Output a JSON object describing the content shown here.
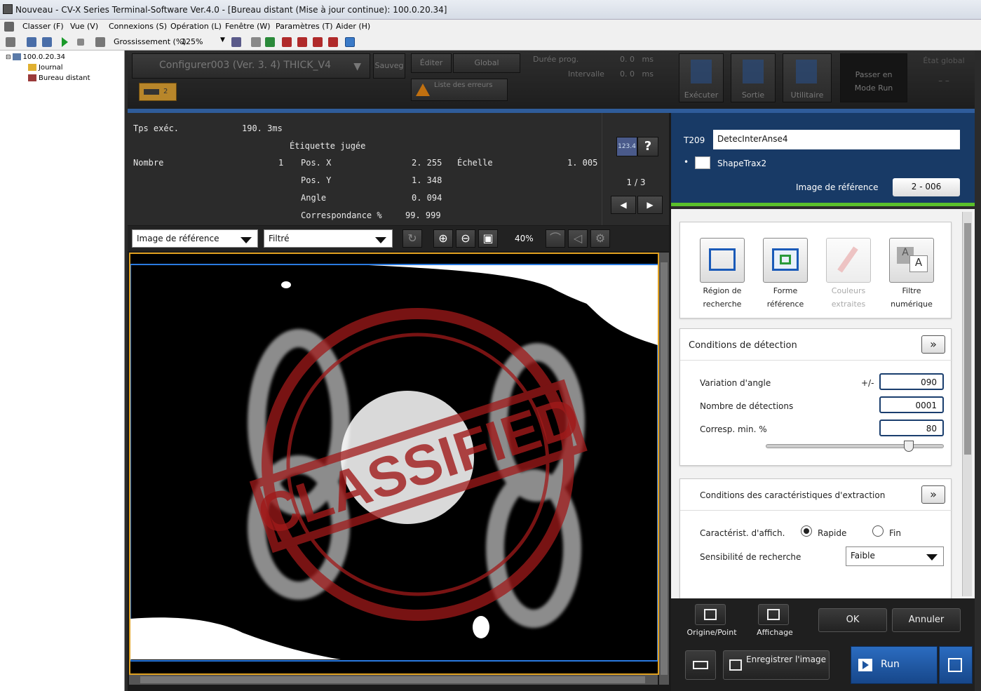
{
  "window": {
    "title": "Nouveau - CV-X Series Terminal-Software Ver.4.0 - [Bureau distant (Mise à jour continue): 100.0.20.34]"
  },
  "menu": {
    "items": [
      "Classer (F)",
      "Vue (V)",
      "Connexions (S)",
      "Opération (L)",
      "Fenêtre (W)",
      "Paramètres (T)",
      "Aider (H)"
    ]
  },
  "toolbar": {
    "zoom_label": "Grossissement (%)",
    "zoom_value": "125%"
  },
  "tree": {
    "root": "100.0.20.34",
    "children": [
      "Journal",
      "Bureau distant"
    ]
  },
  "topbar": {
    "program": "Configurer003  (Ver. 3. 4)  THICK_V4",
    "save": "Sauveg",
    "edit": "Éditer",
    "global": "Global",
    "duration_label": "Durée prog.",
    "interval_label": "Intervalle",
    "duration_val": "0. 0   ms",
    "interval_val": "0. 0   ms",
    "errors_label": "Liste des erreurs",
    "camera_num": "2",
    "execute": "Exécuter",
    "output": "Sortie",
    "utility": "Utilitaire",
    "run_mode": "Passer en Mode Run",
    "global_state": "État global",
    "global_state_val": "– –"
  },
  "results": {
    "exec_time_label": "Tps exéc.",
    "exec_time": "190. 3ms",
    "judged_label": "Étiquette jugée",
    "count_label": "Nombre",
    "count": "1",
    "posx_label": "Pos. X",
    "posx": "2. 255",
    "scale_label": "Échelle",
    "scale": "1. 005",
    "posy_label": "Pos. Y",
    "posy": "1. 348",
    "angle_label": "Angle",
    "angle": "0. 094",
    "match_label": "Correspondance %",
    "match": "99. 999",
    "page": "1 / 3",
    "num_btn": "123.4",
    "help_btn": "?"
  },
  "imagebar": {
    "view": "Image de référence",
    "filter": "Filtré",
    "zoom": "40%"
  },
  "stamp": {
    "text": "CLASSIFIED"
  },
  "tool": {
    "id": "T209",
    "name": "DetecInterAnse4",
    "type": "ShapeTrax2",
    "ref_image_label": "Image de référence",
    "ref_image": "2 - 006"
  },
  "tool_icons": [
    {
      "label1": "Région de",
      "label2": "recherche",
      "enabled": true
    },
    {
      "label1": "Forme",
      "label2": "référence",
      "enabled": true
    },
    {
      "label1": "Couleurs",
      "label2": "extraites",
      "enabled": false
    },
    {
      "label1": "Filtre",
      "label2": "numérique",
      "enabled": true
    }
  ],
  "detection": {
    "title": "Conditions de détection",
    "angle_label": "Variation d'angle",
    "angle_pm": "+/-",
    "angle": "090",
    "count_label": "Nombre de détections",
    "count": "0001",
    "corr_label": "Corresp. min. %",
    "corr": "80",
    "corr_slider": 0.8
  },
  "extraction": {
    "title": "Conditions des caractéristiques d'extraction",
    "display_label": "Caractérist. d'affich.",
    "opt_fast": "Rapide",
    "opt_fine": "Fin",
    "sens_label": "Sensibilité de recherche",
    "sens": "Faible"
  },
  "footer": {
    "origin": "Origine/Point",
    "display": "Affichage",
    "ok": "OK",
    "cancel": "Annuler",
    "save_image": "Enregistrer l'image",
    "run": "Run"
  }
}
